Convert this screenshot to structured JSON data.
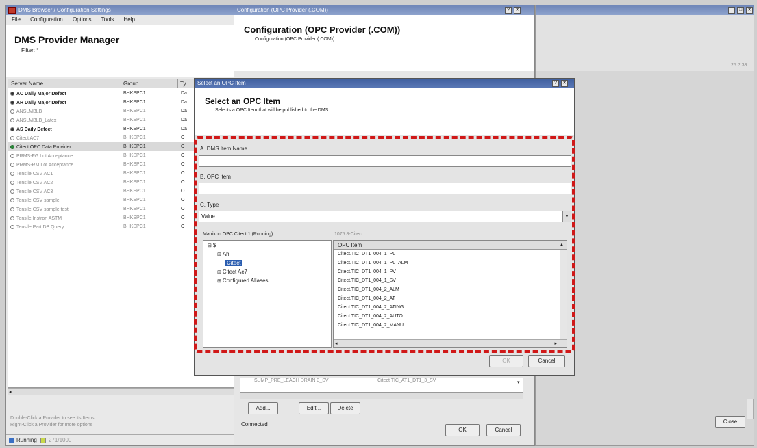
{
  "main_window": {
    "title": "DMS Browser / Configuration Settings",
    "menu": [
      "File",
      "Configuration",
      "Options",
      "Tools",
      "Help"
    ],
    "heading": "DMS Provider Manager",
    "filter": "Filter: *",
    "columns": [
      "Server Name",
      "Group",
      "Ty"
    ],
    "providers": [
      {
        "name": "AC Daily Major Defect",
        "group": "BHKSPC1",
        "ty": "Da",
        "state": "on"
      },
      {
        "name": "AH Daily Major Defect",
        "group": "BHKSPC1",
        "ty": "Da",
        "state": "on"
      },
      {
        "name": "ANSLMBLB",
        "group": "BHKSPC1",
        "ty": "Da",
        "state": "off"
      },
      {
        "name": "ANSLMBLB_Latex",
        "group": "BHKSPC1",
        "ty": "Da",
        "state": "off"
      },
      {
        "name": "AS Daily Defect",
        "group": "BHKSPC1",
        "ty": "Da",
        "state": "on"
      },
      {
        "name": "Citect AC7",
        "group": "BHKSPC1",
        "ty": "O",
        "state": "off"
      },
      {
        "name": "Citect OPC Data Provider",
        "group": "BHKSPC1",
        "ty": "O",
        "state": "sel"
      },
      {
        "name": "PRMS-FG Lot Acceptance",
        "group": "BHKSPC1",
        "ty": "O",
        "state": "off"
      },
      {
        "name": "PRMS-RM Lot Acceptance",
        "group": "BHKSPC1",
        "ty": "O",
        "state": "off"
      },
      {
        "name": "Tensile CSV AC1",
        "group": "BHKSPC1",
        "ty": "O",
        "state": "off"
      },
      {
        "name": "Tensile CSV AC2",
        "group": "BHKSPC1",
        "ty": "O",
        "state": "off"
      },
      {
        "name": "Tensile CSV AC3",
        "group": "BHKSPC1",
        "ty": "O",
        "state": "off"
      },
      {
        "name": "Tensile CSV sample",
        "group": "BHKSPC1",
        "ty": "O",
        "state": "off"
      },
      {
        "name": "Tensile CSV sample test",
        "group": "BHKSPC1",
        "ty": "O",
        "state": "off"
      },
      {
        "name": "Tensile Instron ASTM",
        "group": "BHKSPC1",
        "ty": "O",
        "state": "off"
      },
      {
        "name": "Tensile Part DB Query",
        "group": "BHKSPC1",
        "ty": "O",
        "state": "off"
      }
    ],
    "hint1": "Double-Click a Provider to see its Items",
    "hint2": "Right-Click a Provider for more options",
    "status_running": "Running",
    "status_count": "271/1000",
    "close_label": "Close"
  },
  "config_window": {
    "title": "Configuration (OPC Provider (.COM))",
    "heading": "Configuration (OPC Provider (.COM))",
    "subheading": "Configuration (OPC Provider (.COM))",
    "behind_row": "SUMP_PRE_LEACH DRAIN 3_SV",
    "behind_row2": "Citect TIC_AT1_DT1_3_SV",
    "add_label": "Add...",
    "edit_label": "Edit...",
    "delete_label": "Delete",
    "connected_label": "Connected",
    "ok_label": "OK",
    "cancel_label": "Cancel"
  },
  "dialog": {
    "title": "Select an OPC Item",
    "heading": "Select an OPC Item",
    "description": "Selects a OPC Item that will be published to the DMS",
    "label_a": "A. DMS Item Name",
    "value_a": "",
    "label_b": "B. OPC Item",
    "value_b": "",
    "label_c": "C. Type",
    "type_value": "Value",
    "server_label": "Matrikon.OPC.Citect.1 (Running)",
    "path_label": "1075 8-Citect",
    "tree": [
      "$",
      "Ah",
      "Citect",
      "Citect Ac7",
      "Configured Aliases"
    ],
    "list_header": "OPC Item",
    "items": [
      "Citect.TIC_DT1_004_1_PL",
      "Citect.TIC_DT1_004_1_PL_ALM",
      "Citect.TIC_DT1_004_1_PV",
      "Citect.TIC_DT1_004_1_SV",
      "Citect.TIC_DT1_004_2_ALM",
      "Citect.TIC_DT1_004_2_AT",
      "Citect.TIC_DT1_004_2_ATING",
      "Citect.TIC_DT1_004_2_AUTO",
      "Citect.TIC_DT1_004_2_MANU"
    ],
    "ok_label": "OK",
    "cancel_label": "Cancel"
  },
  "right_window": {
    "zoom_text": "25.2.38"
  },
  "colors": {
    "highlight": "#d01818",
    "titlebar": "#7b90c0",
    "selection": "#2a5db0"
  }
}
